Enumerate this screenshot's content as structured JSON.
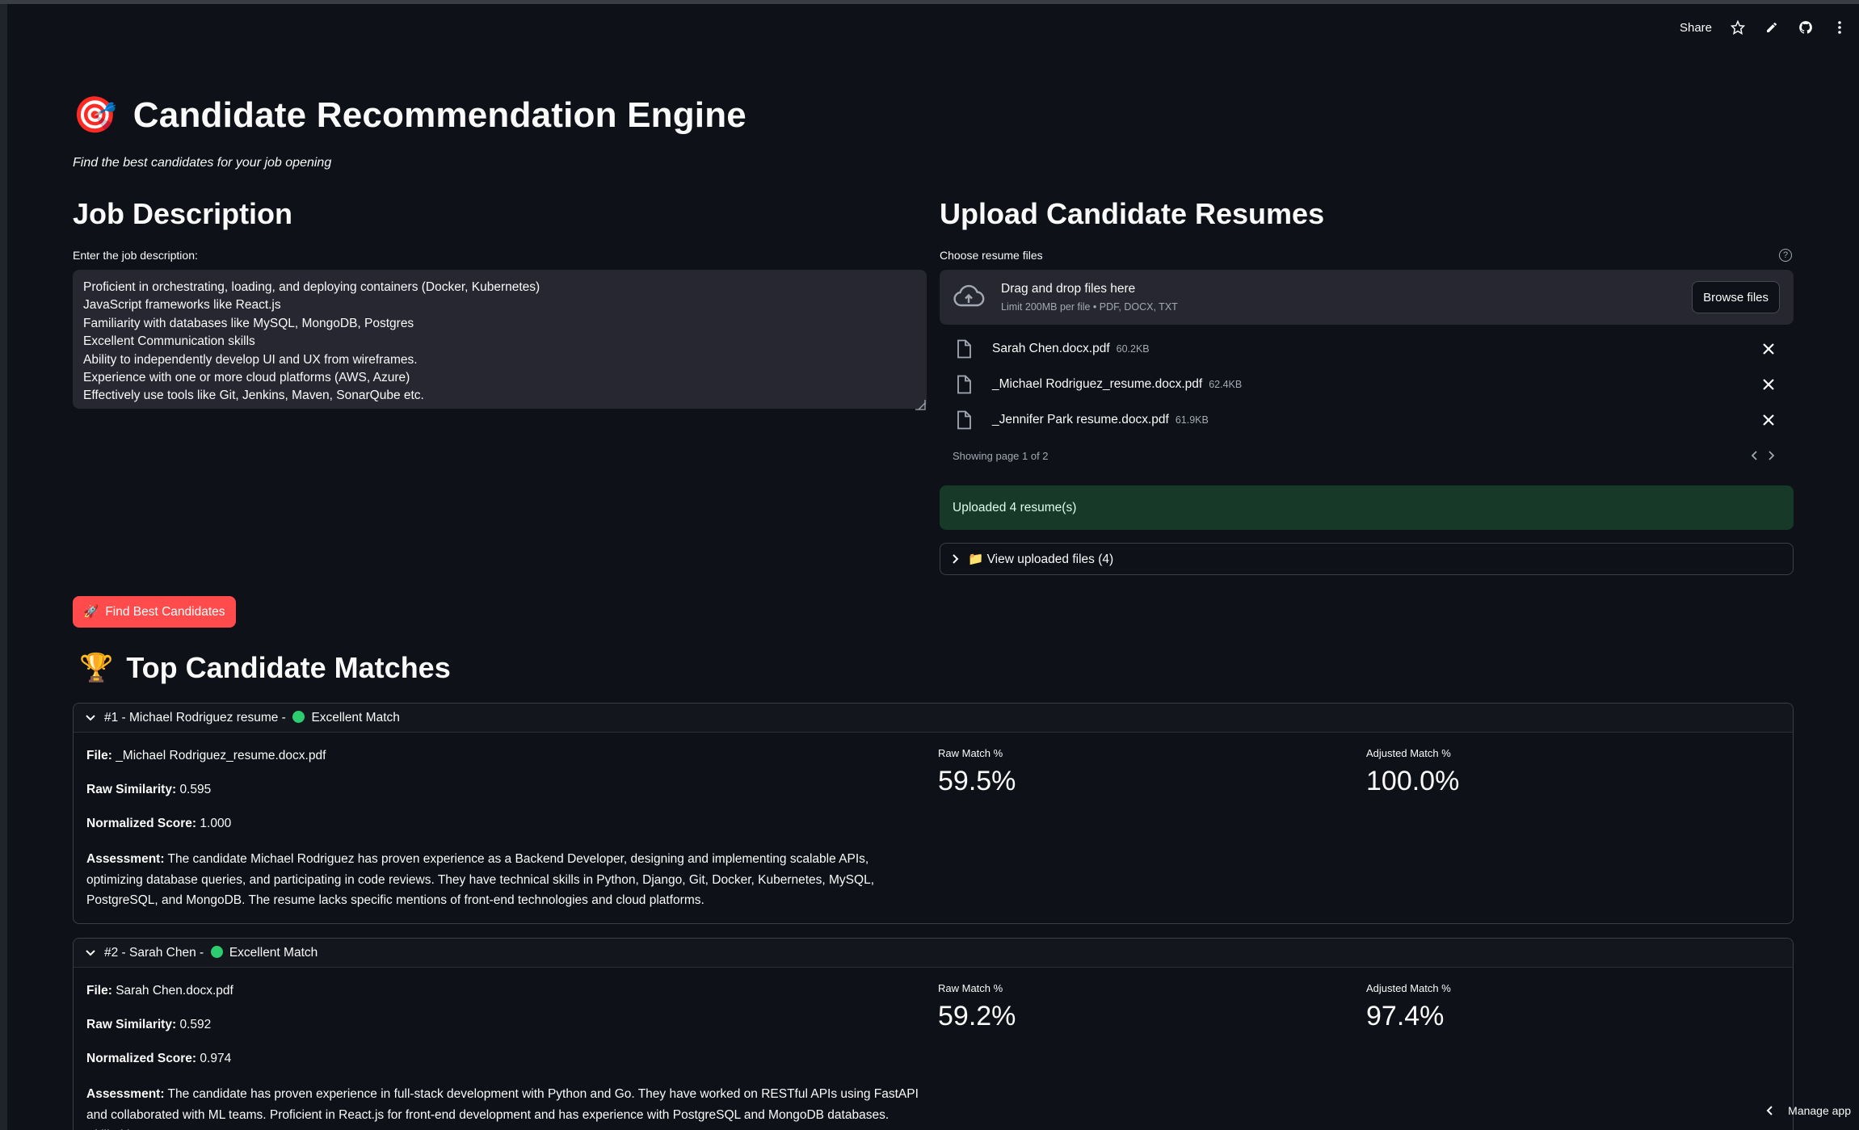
{
  "header": {
    "share_label": "Share",
    "icons": [
      "star-icon",
      "edit-icon",
      "github-icon",
      "more-vertical-icon"
    ]
  },
  "page": {
    "title_emoji": "🎯",
    "title": "Candidate Recommendation Engine",
    "subtitle": "Find the best candidates for your job opening"
  },
  "job": {
    "heading": "Job Description",
    "label": "Enter the job description:",
    "lines": [
      "Proficient in orchestrating, loading, and deploying containers (Docker, Kubernetes)",
      "JavaScript frameworks like React.js",
      "Familiarity with databases like MySQL, MongoDB, Postgres",
      "Excellent Communication skills",
      "Ability to independently develop UI and UX from wireframes.",
      "Experience with one or more cloud platforms (AWS, Azure)",
      "Effectively use tools like Git, Jenkins, Maven, SonarQube etc."
    ]
  },
  "upload": {
    "heading": "Upload Candidate Resumes",
    "label": "Choose resume files",
    "help_icon_text": "?",
    "drop_text": "Drag and drop files here",
    "limit_text": "Limit 200MB per file • PDF, DOCX, TXT",
    "browse_label": "Browse files",
    "files": [
      {
        "name": "Sarah Chen.docx.pdf",
        "size": "60.2KB"
      },
      {
        "name": "_Michael Rodriguez_resume.docx.pdf",
        "size": "62.4KB"
      },
      {
        "name": "_Jennifer Park resume.docx.pdf",
        "size": "61.9KB"
      }
    ],
    "pager_text": "Showing page 1 of 2",
    "success_text": "Uploaded 4 resume(s)",
    "expander_emoji": "📁",
    "expander_label": "View uploaded files (4)"
  },
  "actions": {
    "find_emoji": "🚀",
    "find_label": "Find Best Candidates"
  },
  "results": {
    "heading_emoji": "🏆",
    "heading": "Top Candidate Matches",
    "candidates": [
      {
        "header_prefix": "#1 - Michael Rodriguez resume -",
        "header_suffix": "Excellent Match",
        "file_label": "File:",
        "file": "_Michael Rodriguez_resume.docx.pdf",
        "raw_label": "Raw Similarity:",
        "raw": "0.595",
        "norm_label": "Normalized Score:",
        "norm": "1.000",
        "assessment_label": "Assessment:",
        "assessment": "The candidate Michael Rodriguez has proven experience as a Backend Developer, designing and implementing scalable APIs, optimizing database queries, and participating in code reviews. They have technical skills in Python, Django, Git, Docker, Kubernetes, MySQL, PostgreSQL, and MongoDB. The resume lacks specific mentions of front-end technologies and cloud platforms.",
        "raw_match_label": "Raw Match %",
        "raw_match": "59.5%",
        "adj_match_label": "Adjusted Match %",
        "adj_match": "100.0%"
      },
      {
        "header_prefix": "#2 - Sarah Chen -",
        "header_suffix": "Excellent Match",
        "file_label": "File:",
        "file": "Sarah Chen.docx.pdf",
        "raw_label": "Raw Similarity:",
        "raw": "0.592",
        "norm_label": "Normalized Score:",
        "norm": "0.974",
        "assessment_label": "Assessment:",
        "assessment": "The candidate has proven experience in full-stack development with Python and Go. They have worked on RESTful APIs using FastAPI and collaborated with ML teams. Proficient in React.js for front-end development and has experience with PostgreSQL and MongoDB databases. Skilled in AWS,",
        "raw_match_label": "Raw Match %",
        "raw_match": "59.2%",
        "adj_match_label": "Adjusted Match %",
        "adj_match": "97.4%"
      }
    ]
  },
  "footer": {
    "manage_label": "Manage app"
  },
  "colors": {
    "background": "#0e1117",
    "primary": "#ff4b4b",
    "success_bg": "#173928",
    "match_dot": "#2ecc71"
  }
}
